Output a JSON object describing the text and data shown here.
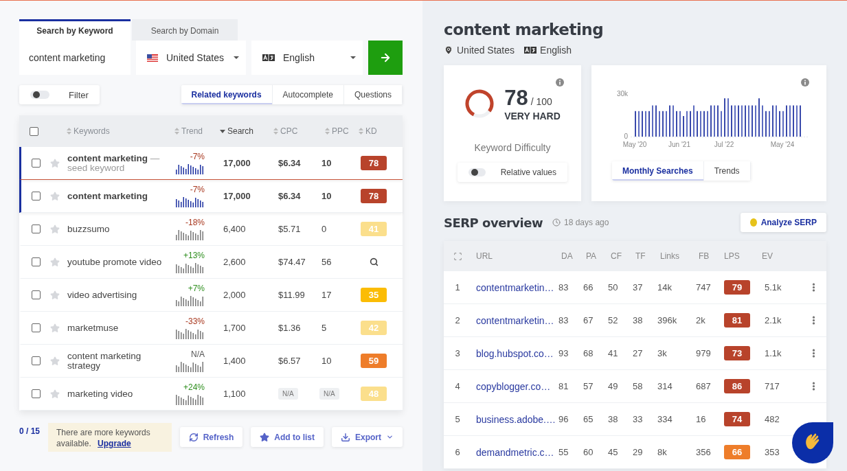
{
  "search_tabs": [
    {
      "label": "Search by Keyword",
      "selected": true
    },
    {
      "label": "Search by Domain",
      "selected": false
    }
  ],
  "search": {
    "value": "content marketing",
    "country": "United States",
    "language": "English"
  },
  "filter": {
    "label": "Filter",
    "on": false
  },
  "result_tabs": [
    {
      "label": "Related keywords",
      "selected": true
    },
    {
      "label": "Autocomplete",
      "selected": false
    },
    {
      "label": "Questions",
      "selected": false
    }
  ],
  "table": {
    "select_all": {
      "checked": false
    },
    "columns": [
      {
        "label": "Keywords",
        "sorted": false
      },
      {
        "label": "Trend",
        "sorted": false
      },
      {
        "label": "Search",
        "sorted": true
      },
      {
        "label": "CPC",
        "sorted": false
      },
      {
        "label": "PPC",
        "sorted": false
      },
      {
        "label": "KD",
        "sorted": false
      }
    ],
    "rows": [
      {
        "kind": "seed",
        "keyword": "content marketing",
        "note": "— seed keyword",
        "selected": true,
        "checked": false,
        "starred": false,
        "trend": {
          "text": "-7%",
          "color": "#a8381f"
        },
        "search": "17,000",
        "cpc": "$6.34",
        "ppc": "10",
        "unavailable": false,
        "kd": {
          "kind": "score",
          "value": "78",
          "color": "#b8432b"
        }
      },
      {
        "kind": "keyword",
        "keyword": "content marketing",
        "selected": true,
        "checked": false,
        "starred": false,
        "trend": {
          "text": "-7%",
          "color": "#a8381f"
        },
        "search": "17,000",
        "cpc": "$6.34",
        "ppc": "10",
        "unavailable": false,
        "kd": {
          "kind": "score",
          "value": "78",
          "color": "#b8432b"
        }
      },
      {
        "kind": "keyword",
        "keyword": "buzzsumo",
        "selected": false,
        "checked": false,
        "starred": false,
        "trend": {
          "text": "-18%",
          "color": "#a8381f"
        },
        "search": "6,400",
        "cpc": "$5.71",
        "ppc": "0",
        "unavailable": false,
        "kd": {
          "kind": "score",
          "value": "41",
          "color": "#fbdf8c"
        }
      },
      {
        "kind": "keyword",
        "keyword": "youtube promote video",
        "selected": false,
        "checked": false,
        "starred": false,
        "trend": {
          "text": "+13%",
          "color": "#2f8f1f"
        },
        "search": "2,600",
        "cpc": "$74.47",
        "ppc": "56",
        "unavailable": false,
        "kd": {
          "kind": "search"
        }
      },
      {
        "kind": "keyword",
        "keyword": "video advertising",
        "selected": false,
        "checked": false,
        "starred": false,
        "trend": {
          "text": "+7%",
          "color": "#2f8f1f"
        },
        "search": "2,000",
        "cpc": "$11.99",
        "ppc": "17",
        "unavailable": false,
        "kd": {
          "kind": "score",
          "value": "35",
          "color": "#fbbc05"
        }
      },
      {
        "kind": "keyword",
        "keyword": "marketmuse",
        "selected": false,
        "checked": false,
        "starred": false,
        "trend": {
          "text": "-33%",
          "color": "#a8381f"
        },
        "search": "1,700",
        "cpc": "$1.36",
        "ppc": "5",
        "unavailable": false,
        "kd": {
          "kind": "score",
          "value": "42",
          "color": "#fbdf8c"
        }
      },
      {
        "kind": "keyword",
        "keyword": "content marketing strategy",
        "selected": false,
        "checked": false,
        "starred": false,
        "trend": {
          "text": "N/A",
          "color": "#555555"
        },
        "search": "1,400",
        "cpc": "$6.57",
        "ppc": "10",
        "unavailable": false,
        "kd": {
          "kind": "score",
          "value": "59",
          "color": "#ee7d2a"
        }
      },
      {
        "kind": "keyword",
        "keyword": "marketing video",
        "selected": false,
        "checked": false,
        "starred": false,
        "trend": {
          "text": "+24%",
          "color": "#2f8f1f"
        },
        "search": "1,100",
        "cpc": "N/A",
        "ppc": "N/A",
        "unavailable": true,
        "kd": {
          "kind": "score",
          "value": "48",
          "color": "#fbdf8c"
        }
      }
    ]
  },
  "footer": {
    "count": "0 / 15",
    "notice": "There are more keywords available.",
    "notice_link": "Upgrade",
    "buttons": [
      {
        "label": "Refresh",
        "kind": "refresh"
      },
      {
        "label": "Add to list",
        "kind": "add"
      },
      {
        "label": "Export",
        "kind": "export"
      }
    ]
  },
  "keyword": {
    "title": "content marketing",
    "country": "United States",
    "language": "English"
  },
  "difficulty": {
    "score": "78",
    "max": "/ 100",
    "rating": "VERY HARD",
    "level": 0.78,
    "caption": "Keyword Difficulty",
    "toggle": {
      "label": "Relative values",
      "on": false
    }
  },
  "searches": {
    "chart_data": {
      "type": "bar",
      "categories": [
        "May '20",
        null,
        null,
        null,
        null,
        null,
        null,
        null,
        null,
        null,
        null,
        null,
        null,
        "Jun '21",
        null,
        null,
        null,
        null,
        null,
        null,
        null,
        null,
        null,
        null,
        null,
        null,
        "Jul '22",
        null,
        null,
        null,
        null,
        null,
        null,
        null,
        null,
        null,
        null,
        null,
        null,
        null,
        null,
        null,
        null,
        "May '24",
        null,
        null,
        null,
        null,
        null
      ],
      "values": [
        18000,
        18000,
        18000,
        18000,
        18000,
        22000,
        22000,
        18000,
        18000,
        18000,
        22000,
        22000,
        18000,
        18000,
        14500,
        18000,
        18000,
        22000,
        18000,
        18000,
        18000,
        18000,
        22000,
        22000,
        22000,
        18000,
        27000,
        27000,
        22000,
        22000,
        22000,
        22000,
        22000,
        22000,
        22000,
        22000,
        27000,
        22000,
        18000,
        18000,
        22000,
        22000,
        18000,
        18000,
        22000,
        22000,
        22000,
        22000,
        22000
      ],
      "ylim": [
        0,
        30000
      ],
      "yticks": [
        {
          "value": 0,
          "label": "0"
        },
        {
          "value": 30000,
          "label": "30k"
        }
      ]
    },
    "tabs": [
      {
        "label": "Monthly Searches",
        "selected": true
      },
      {
        "label": "Trends",
        "selected": false
      }
    ]
  },
  "serp": {
    "title": "SERP overview",
    "updated": "18 days ago",
    "action": "Analyze SERP",
    "columns": [
      "URL",
      "DA",
      "PA",
      "CF",
      "TF",
      "Links",
      "FB",
      "LPS",
      "EV"
    ],
    "rows": [
      {
        "rank": "1",
        "url": "contentmarketin…",
        "da": "83",
        "pa": "66",
        "cf": "50",
        "tf": "37",
        "links": "14k",
        "fb": "747",
        "lps": {
          "value": "79",
          "color": "#b8432b"
        },
        "ev": "5.1k"
      },
      {
        "rank": "2",
        "url": "contentmarketin…",
        "da": "83",
        "pa": "67",
        "cf": "52",
        "tf": "38",
        "links": "396k",
        "fb": "2k",
        "lps": {
          "value": "81",
          "color": "#b8432b"
        },
        "ev": "2.1k"
      },
      {
        "rank": "3",
        "url": "blog.hubspot.co…",
        "da": "93",
        "pa": "68",
        "cf": "41",
        "tf": "27",
        "links": "3k",
        "fb": "979",
        "lps": {
          "value": "73",
          "color": "#b8432b"
        },
        "ev": "1.1k"
      },
      {
        "rank": "4",
        "url": "copyblogger.co…",
        "da": "81",
        "pa": "57",
        "cf": "49",
        "tf": "58",
        "links": "314",
        "fb": "687",
        "lps": {
          "value": "86",
          "color": "#b8432b"
        },
        "ev": "717"
      },
      {
        "rank": "5",
        "url": "business.adobe.…",
        "da": "96",
        "pa": "65",
        "cf": "38",
        "tf": "33",
        "links": "334",
        "fb": "16",
        "lps": {
          "value": "74",
          "color": "#b8432b"
        },
        "ev": "482"
      },
      {
        "rank": "6",
        "url": "demandmetric.c…",
        "da": "55",
        "pa": "60",
        "cf": "45",
        "tf": "29",
        "links": "8k",
        "fb": "356",
        "lps": {
          "value": "66",
          "color": "#ee7d2a"
        },
        "ev": "353"
      }
    ]
  }
}
